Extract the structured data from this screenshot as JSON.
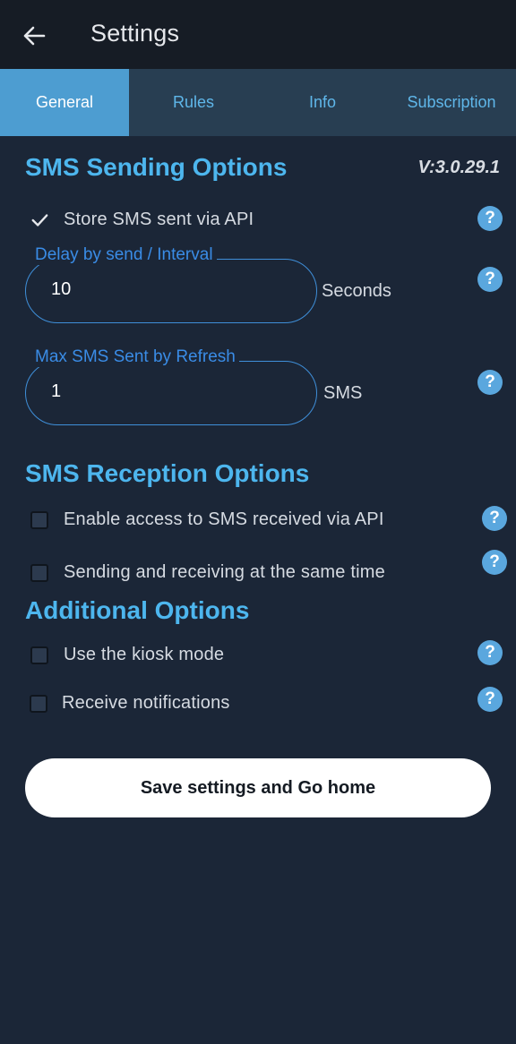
{
  "appbar": {
    "title": "Settings",
    "back_icon": "arrow-left-icon"
  },
  "tabs": [
    {
      "label": "General",
      "active": true
    },
    {
      "label": "Rules",
      "active": false
    },
    {
      "label": "Info",
      "active": false
    },
    {
      "label": "Subscription",
      "active": false
    }
  ],
  "sending": {
    "title": "SMS Sending Options",
    "version": "V:3.0.29.1",
    "store_sms": {
      "label": "Store SMS sent via API",
      "checked": true
    },
    "delay": {
      "label": "Delay by send / Interval",
      "value": "10",
      "unit": "Seconds"
    },
    "max_sms": {
      "label": "Max SMS Sent by Refresh",
      "value": "1",
      "unit": "SMS"
    }
  },
  "reception": {
    "title": "SMS Reception Options",
    "enable_access": {
      "label": "Enable access to SMS received via API",
      "checked": false
    },
    "same_time": {
      "label": "Sending and receiving at the same time",
      "checked": false
    }
  },
  "additional": {
    "title": "Additional Options",
    "kiosk": {
      "label": "Use the kiosk mode",
      "checked": false
    },
    "notifications": {
      "label": "Receive notifications",
      "checked": false
    }
  },
  "help_glyph": "?",
  "save_label": "Save settings and Go home",
  "colors": {
    "background": "#1b2637",
    "appbar": "#161c25",
    "tabbar": "#283e52",
    "tab_active": "#4d9dd1",
    "accent": "#4db6ee",
    "field_border": "#3f8fd9",
    "help": "#5aa7de"
  }
}
